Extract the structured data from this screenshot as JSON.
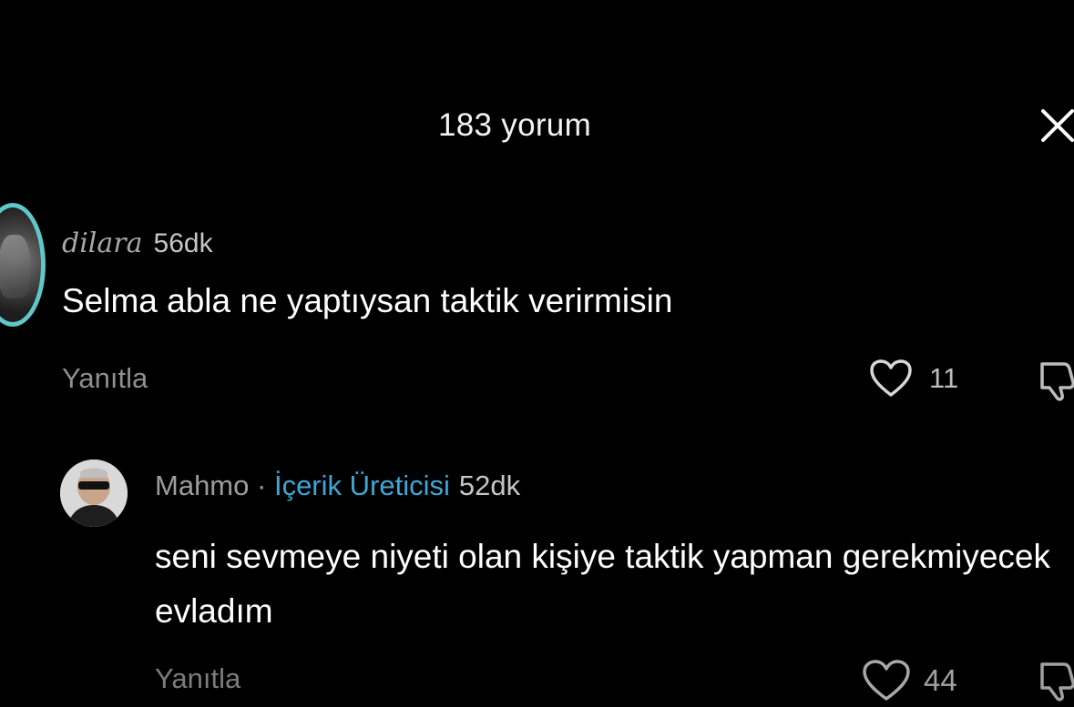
{
  "header": {
    "title": "183 yorum",
    "close_icon": "close-icon"
  },
  "comments": [
    {
      "username": "dilara",
      "time": "56dk",
      "text": "Selma abla ne yaptıysan taktik verirmisin",
      "reply_label": "Yanıtla",
      "likes": "11",
      "avatar_ring_color": "#5fc6c9"
    },
    {
      "username": "Mahmo",
      "separator": "·",
      "badge": "İçerik Üreticisi",
      "time": "52dk",
      "text": "seni sevmeye niyeti olan kişiye taktik yapman gerekmiyecek evladım",
      "reply_label": "Yanıtla",
      "likes": "44",
      "badge_color": "#3ea7d6"
    }
  ]
}
